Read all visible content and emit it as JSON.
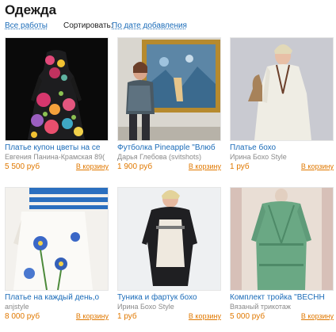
{
  "page": {
    "title": "Одежда",
    "all_works": "Все работы",
    "sort_label": "Сортировать:",
    "sort_value": "По дате добавления"
  },
  "products": [
    {
      "name": "Платье купон цветы на се",
      "author": "Евгения Панина-Крамская 89(",
      "price": "5 500 руб",
      "cart": "В корзину"
    },
    {
      "name": "Футболка Pineapple \"Влюб",
      "author": "Дарья Глебова (svitshots)",
      "price": "1 900 руб",
      "cart": "В корзину"
    },
    {
      "name": "Платье бохо",
      "author": "Ирина Бохо Style",
      "price": "1 руб",
      "cart": "В корзину"
    },
    {
      "name": "Платье на каждый день,о",
      "author": "anjstyle",
      "price": "8 000 руб",
      "cart": "В корзину"
    },
    {
      "name": "Туника и фартук бохо",
      "author": "Ирина Бохо Style",
      "price": "1 руб",
      "cart": "В корзину"
    },
    {
      "name": "Комплект тройка \"ВЕСНН",
      "author": "Вязаный трикотаж",
      "price": "5 000 руб",
      "cart": "В корзину"
    }
  ]
}
